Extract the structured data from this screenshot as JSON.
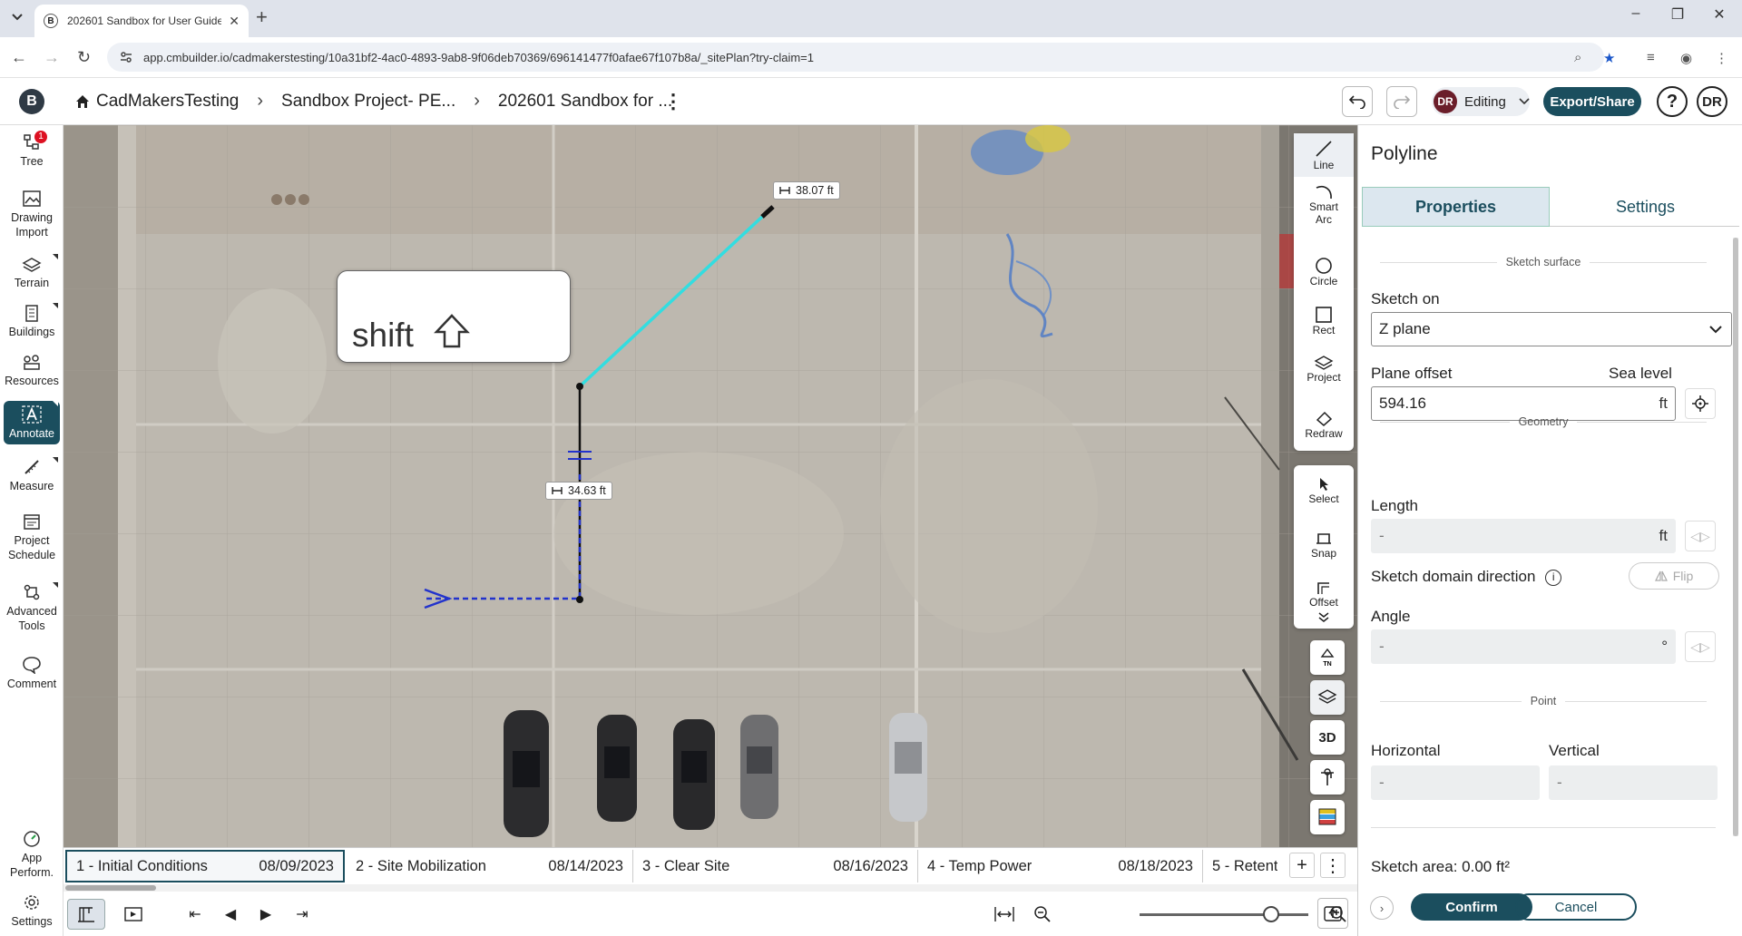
{
  "browser": {
    "tab_title": "202601 Sandbox for User Guide",
    "new_tab": "+",
    "url": "app.cmbuilder.io/cadmakerstesting/10a31bf2-4ac0-4893-9ab8-9f06deb70369/696141477f0afae67f107b8a/_sitePlan?try-claim=1",
    "window_controls": [
      "–",
      "❐",
      "✕"
    ]
  },
  "header": {
    "logo": "B",
    "breadcrumbs": [
      "CadMakersTesting",
      "Sandbox Project- PE...",
      "202601 Sandbox for ..."
    ],
    "editing_initials": "DR",
    "editing_label": "Editing",
    "export_label": "Export/Share",
    "help_label": "?",
    "user_initials": "DR"
  },
  "sidebar": {
    "tree_badge": "1",
    "items": [
      {
        "label": "Tree",
        "icon": "tree-icon"
      },
      {
        "label": "Drawing Import",
        "icon": "image-icon"
      },
      {
        "label": "Terrain",
        "icon": "terrain-icon"
      },
      {
        "label": "Buildings",
        "icon": "building-icon"
      },
      {
        "label": "Resources",
        "icon": "resources-icon"
      },
      {
        "label": "Annotate",
        "icon": "annotate-icon"
      },
      {
        "label": "Measure",
        "icon": "ruler-icon"
      },
      {
        "label": "Project Schedule",
        "icon": "schedule-icon"
      },
      {
        "label": "Advanced Tools",
        "icon": "advanced-tools-icon"
      },
      {
        "label": "Comment",
        "icon": "comment-icon"
      },
      {
        "label": "App Perform.",
        "icon": "performance-icon"
      },
      {
        "label": "Settings",
        "icon": "gear-icon"
      }
    ]
  },
  "canvas": {
    "shift_key_label": "shift",
    "dim_label_1": "38.07  ft",
    "dim_label_2": "34.63  ft"
  },
  "tools": {
    "line": "Line",
    "smart_arc": "Smart Arc",
    "circle": "Circle",
    "rect": "Rect",
    "project": "Project",
    "redraw": "Redraw",
    "select": "Select",
    "snap": "Snap",
    "offset": "Offset",
    "view_tn": "TN",
    "view_3d": "3D"
  },
  "timeline": {
    "phases": [
      {
        "name": "1 - Initial Conditions",
        "date": "08/09/2023"
      },
      {
        "name": "2 - Site Mobilization",
        "date": "08/14/2023"
      },
      {
        "name": "3 - Clear Site",
        "date": "08/16/2023"
      },
      {
        "name": "4 - Temp Power",
        "date": "08/18/2023"
      },
      {
        "name": "5 - Retent",
        "date": ""
      }
    ],
    "add": "+",
    "more": "⋮"
  },
  "panel": {
    "title": "Polyline",
    "tabs": [
      "Properties",
      "Settings"
    ],
    "sketch_surface_label": "Sketch surface",
    "sketch_on_label": "Sketch on",
    "sketch_on_value": "Z plane",
    "plane_offset_label": "Plane offset",
    "sea_level_label": "Sea level",
    "plane_offset_value": "594.16",
    "unit_ft": "ft",
    "geometry_label": "Geometry",
    "length_label": "Length",
    "length_value": "-",
    "direction_label": "Sketch domain direction",
    "flip_label": "Flip",
    "angle_label": "Angle",
    "angle_value": "-",
    "angle_unit": "°",
    "point_label": "Point",
    "horizontal_label": "Horizontal",
    "vertical_label": "Vertical",
    "horizontal_value": "-",
    "vertical_value": "-",
    "sketch_area": "Sketch area: 0.00 ft²",
    "confirm": "Confirm",
    "cancel": "Cancel"
  },
  "colors": {
    "primary": "#1b4e5e",
    "segment_active": "#33dde0",
    "segment_drawn": "#111111",
    "construction_line": "#2233cc"
  }
}
